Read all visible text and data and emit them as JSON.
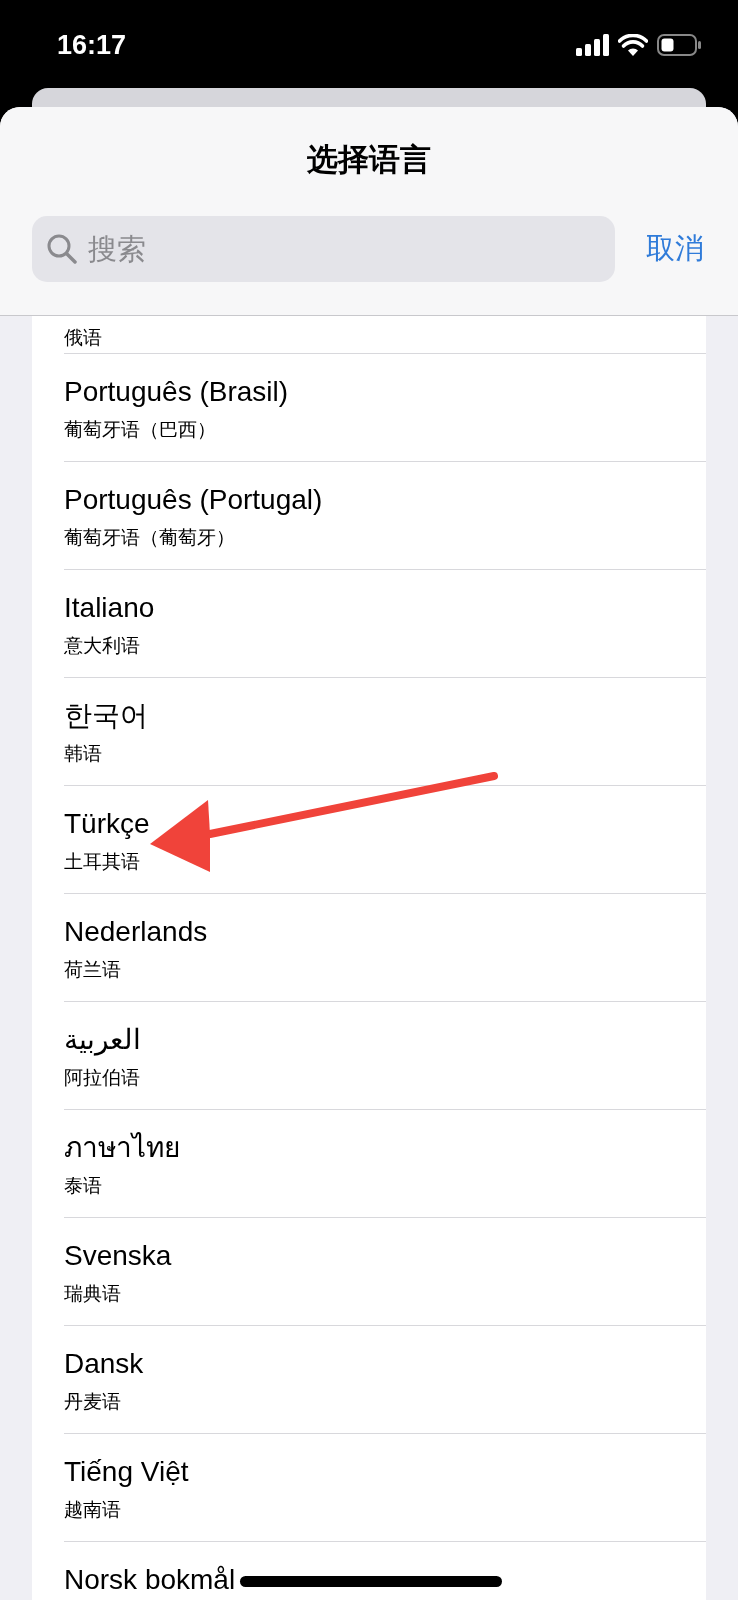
{
  "status_bar": {
    "time": "16:17"
  },
  "sheet": {
    "title": "选择语言",
    "search": {
      "placeholder": "搜索"
    },
    "cancel": "取消"
  },
  "languages": [
    {
      "subtitle": "俄语"
    },
    {
      "name": "Português (Brasil)",
      "subtitle": "葡萄牙语（巴西）"
    },
    {
      "name": "Português (Portugal)",
      "subtitle": "葡萄牙语（葡萄牙）"
    },
    {
      "name": "Italiano",
      "subtitle": "意大利语"
    },
    {
      "name": "한국어",
      "subtitle": "韩语"
    },
    {
      "name": "Türkçe",
      "subtitle": "土耳其语"
    },
    {
      "name": "Nederlands",
      "subtitle": "荷兰语"
    },
    {
      "name": "العربية",
      "subtitle": "阿拉伯语"
    },
    {
      "name": "ภาษาไทย",
      "subtitle": "泰语"
    },
    {
      "name": "Svenska",
      "subtitle": "瑞典语"
    },
    {
      "name": "Dansk",
      "subtitle": "丹麦语"
    },
    {
      "name": "Tiếng Việt",
      "subtitle": "越南语"
    },
    {
      "name": "Norsk bokmål"
    }
  ]
}
